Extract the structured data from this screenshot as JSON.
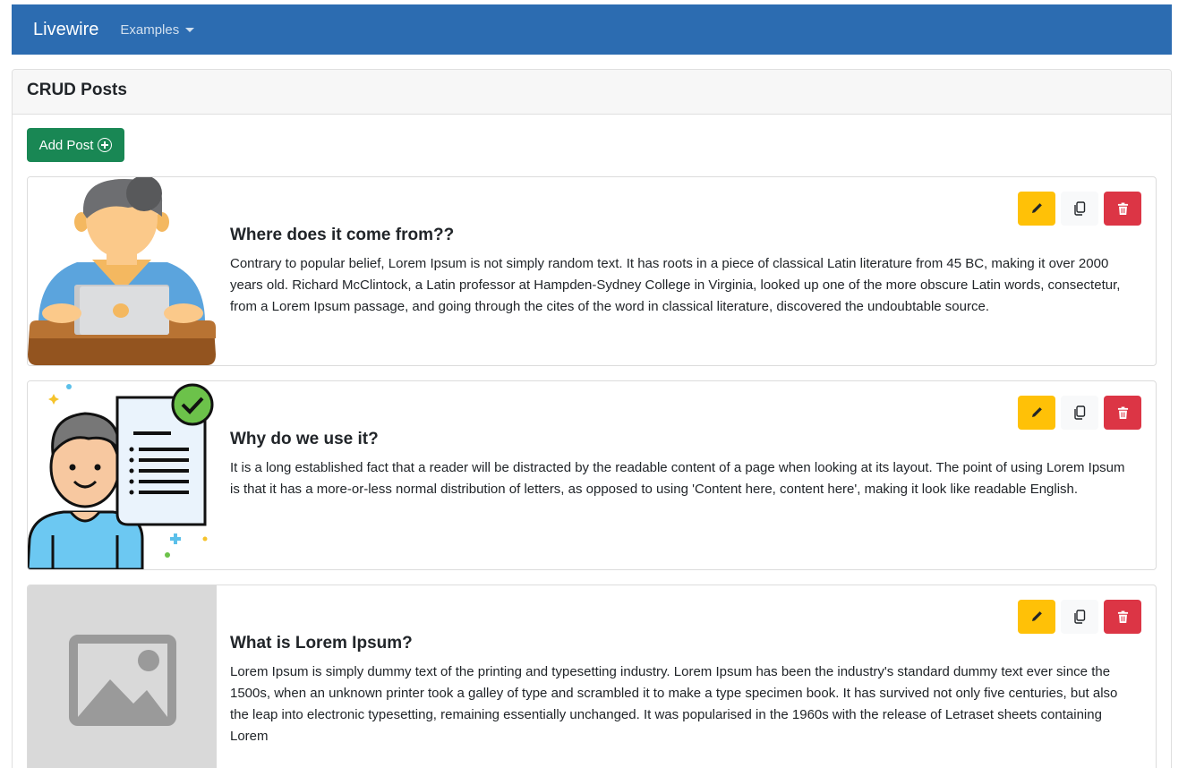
{
  "navbar": {
    "brand": "Livewire",
    "examples_label": "Examples"
  },
  "card": {
    "title": "CRUD Posts"
  },
  "add_button": {
    "label": "Add Post"
  },
  "posts": [
    {
      "title": "Where does it come from??",
      "body": "Contrary to popular belief, Lorem Ipsum is not simply random text. It has roots in a piece of classical Latin literature from 45 BC, making it over 2000 years old. Richard McClintock, a Latin professor at Hampden-Sydney College in Virginia, looked up one of the more obscure Latin words, consectetur, from a Lorem Ipsum passage, and going through the cites of the word in classical literature, discovered the undoubtable source.",
      "image": "person-laptop-illustration"
    },
    {
      "title": "Why do we use it?",
      "body": "It is a long established fact that a reader will be distracted by the readable content of a page when looking at its layout. The point of using Lorem Ipsum is that it has a more-or-less normal distribution of letters, as opposed to using 'Content here, content here', making it look like readable English.",
      "image": "person-document-checkmark-illustration"
    },
    {
      "title": "What is Lorem Ipsum?",
      "body": "Lorem Ipsum is simply dummy text of the printing and typesetting industry. Lorem Ipsum has been the industry's standard dummy text ever since the 1500s, when an unknown printer took a galley of type and scrambled it to make a type specimen book. It has survived not only five centuries, but also the leap into electronic typesetting, remaining essentially unchanged. It was popularised in the 1960s with the release of Letraset sheets containing Lorem",
      "image": "image-placeholder-icon"
    }
  ],
  "icons": {
    "edit": "pencil-icon",
    "copy": "copy-icon",
    "delete": "trash-icon",
    "add": "plus-circle-icon",
    "dropdown": "caret-down-icon"
  },
  "colors": {
    "navbar": "#2c6cb1",
    "add": "#198754",
    "edit": "#ffc107",
    "delete": "#dc3545",
    "copy": "#f8f9fa"
  }
}
